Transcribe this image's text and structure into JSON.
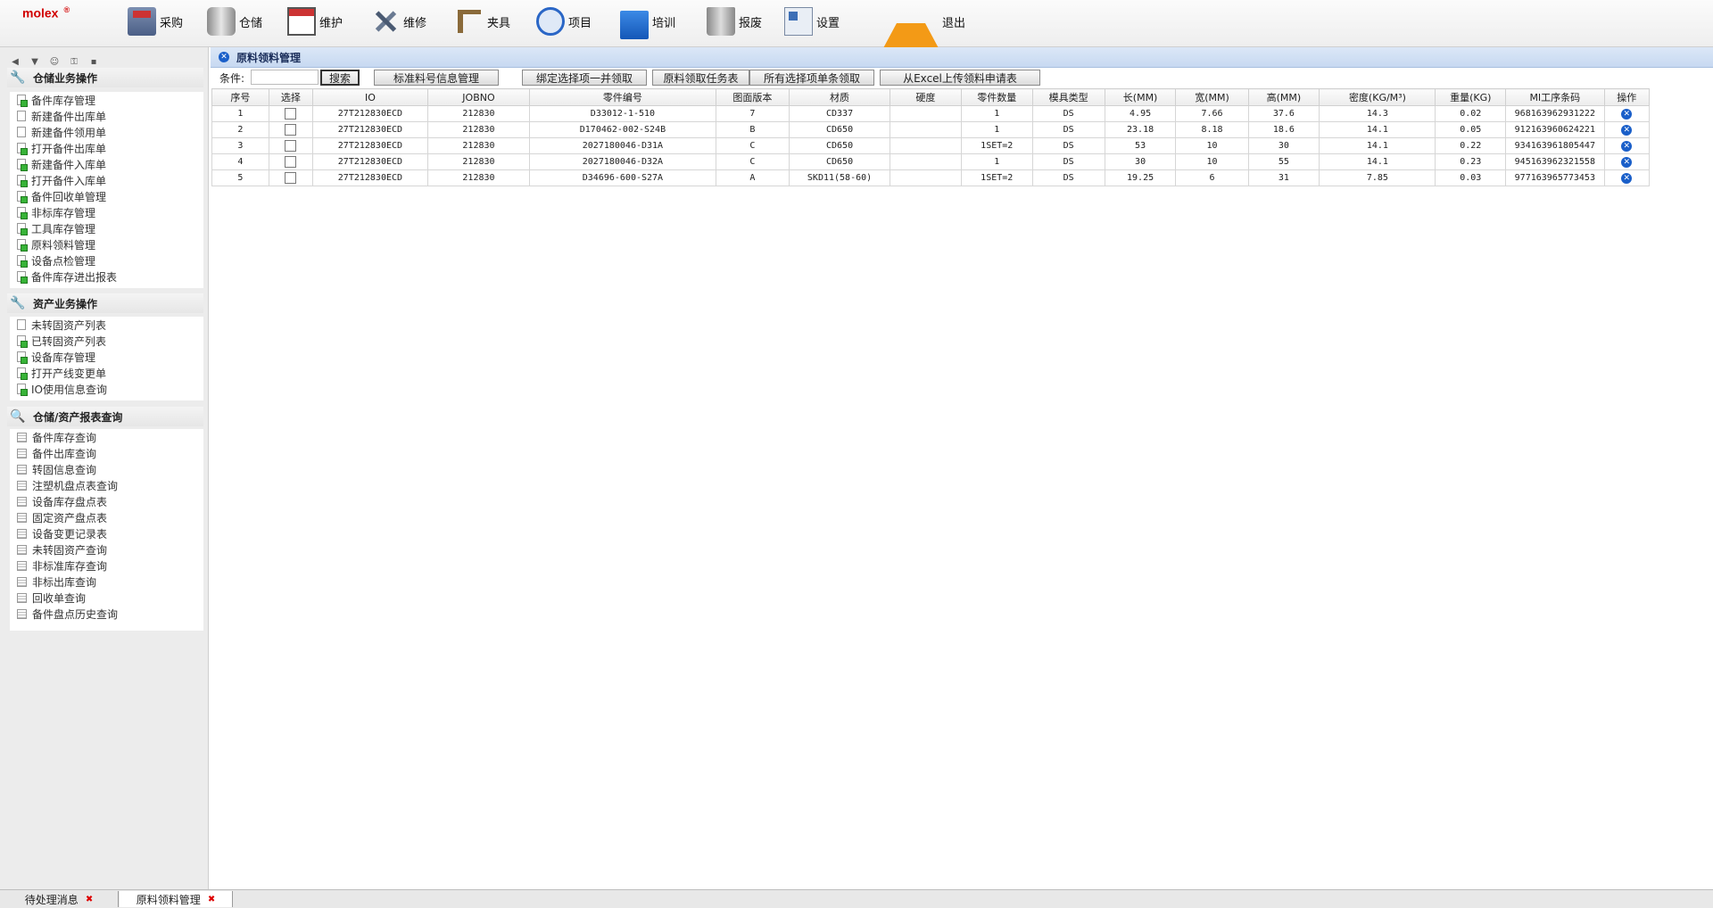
{
  "app": {
    "logo": "molex",
    "logo_mark": "®"
  },
  "topnav": [
    {
      "label": "采购",
      "icon": "cart-icon"
    },
    {
      "label": "仓储",
      "icon": "database-icon"
    },
    {
      "label": "维护",
      "icon": "calendar-icon"
    },
    {
      "label": "维修",
      "icon": "tools-icon"
    },
    {
      "label": "夹具",
      "icon": "clamp-icon"
    },
    {
      "label": "项目",
      "icon": "clock-icon"
    },
    {
      "label": "培训",
      "icon": "folder-icon"
    },
    {
      "label": "报废",
      "icon": "trash-icon"
    },
    {
      "label": "设置",
      "icon": "settings-icon"
    },
    {
      "label": "退出",
      "icon": "warning-icon"
    }
  ],
  "sidebar": {
    "sections": [
      {
        "title": "仓储业务操作",
        "icon": "wrench-icon",
        "items": [
          "备件库存管理",
          "新建备件出库单",
          "新建备件领用单",
          "打开备件出库单",
          "新建备件入库单",
          "打开备件入库单",
          "备件回收单管理",
          "非标库存管理",
          "工具库存管理",
          "原料领料管理",
          "设备点检管理",
          "备件库存进出报表"
        ]
      },
      {
        "title": "资产业务操作",
        "icon": "wrench-icon",
        "items": [
          "未转固资产列表",
          "已转固资产列表",
          "设备库存管理",
          "打开产线变更单",
          "IO使用信息查询"
        ]
      },
      {
        "title": "仓储/资产报表查询",
        "icon": "magnifier-icon",
        "items": [
          "备件库存查询",
          "备件出库查询",
          "转固信息查询",
          "注塑机盘点表查询",
          "设备库存盘点表",
          "固定资产盘点表",
          "设备变更记录表",
          "未转固资产查询",
          "非标准库存查询",
          "非标出库查询",
          "回收单查询",
          "备件盘点历史查询"
        ]
      }
    ]
  },
  "panel": {
    "title": "原料领料管理",
    "condition_label": "条件:",
    "condition_value": "",
    "buttons": {
      "search": "搜索",
      "std_material": "标准料号信息管理",
      "bind_selected": "绑定选择项一并领取",
      "task_table": "原料领取任务表",
      "all_selected": "所有选择项单条领取",
      "excel_upload": "从Excel上传领料申请表"
    }
  },
  "table": {
    "headers": [
      "序号",
      "选择",
      "IO",
      "JOBNO",
      "零件编号",
      "图面版本",
      "材质",
      "硬度",
      "零件数量",
      "模具类型",
      "长(MM)",
      "宽(MM)",
      "高(MM)",
      "密度(KG/M³)",
      "重量(KG)",
      "MI工序条码",
      "操作"
    ],
    "rows": [
      [
        "1",
        "",
        "27T212830ECD",
        "212830",
        "D33012-1-510",
        "7",
        "CD337",
        "",
        "1",
        "DS",
        "4.95",
        "7.66",
        "37.6",
        "14.3",
        "0.02",
        "968163962931222",
        ""
      ],
      [
        "2",
        "",
        "27T212830ECD",
        "212830",
        "D170462-002-S24B",
        "B",
        "CD650",
        "",
        "1",
        "DS",
        "23.18",
        "8.18",
        "18.6",
        "14.1",
        "0.05",
        "912163960624221",
        ""
      ],
      [
        "3",
        "",
        "27T212830ECD",
        "212830",
        "2027180046-D31A",
        "C",
        "CD650",
        "",
        "1SET=2",
        "DS",
        "53",
        "10",
        "30",
        "14.1",
        "0.22",
        "934163961805447",
        ""
      ],
      [
        "4",
        "",
        "27T212830ECD",
        "212830",
        "2027180046-D32A",
        "C",
        "CD650",
        "",
        "1",
        "DS",
        "30",
        "10",
        "55",
        "14.1",
        "0.23",
        "945163962321558",
        ""
      ],
      [
        "5",
        "",
        "27T212830ECD",
        "212830",
        "D34696-600-S27A",
        "A",
        "SKD11(58-60)",
        "",
        "1SET=2",
        "DS",
        "19.25",
        "6",
        "31",
        "7.85",
        "0.03",
        "977163965773453",
        ""
      ]
    ]
  },
  "bottom_tabs": [
    {
      "label": "待处理消息",
      "active": false
    },
    {
      "label": "原料领料管理",
      "active": true
    }
  ]
}
